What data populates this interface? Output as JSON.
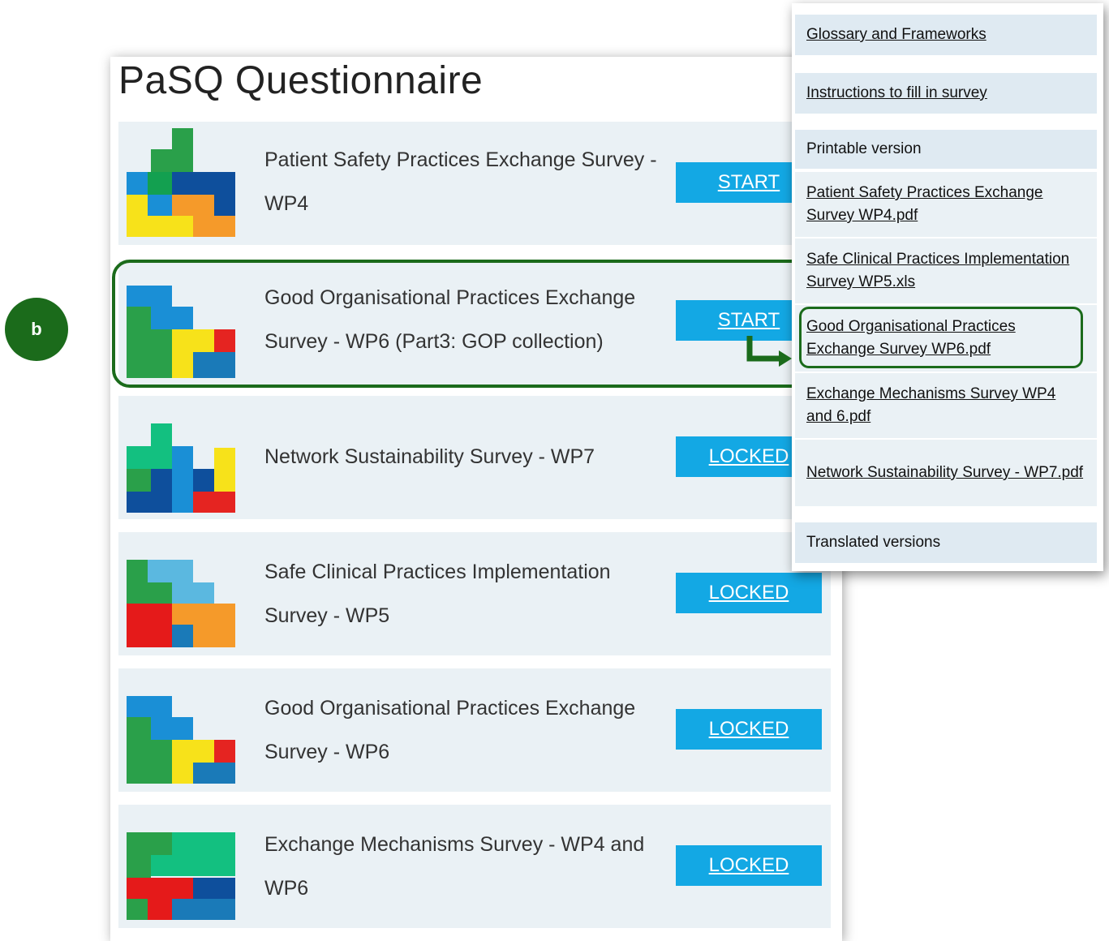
{
  "page": {
    "title": "PaSQ Questionnaire"
  },
  "surveys": [
    {
      "name": "Patient Safety Practices Exchange Survey - WP4",
      "button": "START",
      "logo": "wp4-logo"
    },
    {
      "name": "Good Organisational Practices Exchange Survey - WP6 (Part3: GOP collection)",
      "button": "START",
      "logo": "wp6-logo"
    },
    {
      "name": "Network Sustainability Survey - WP7",
      "button": "LOCKED",
      "logo": "wp7-logo"
    },
    {
      "name": "Safe Clinical Practices Implementation Survey - WP5",
      "button": "LOCKED",
      "logo": "wp5-logo"
    },
    {
      "name": "Good Organisational Practices Exchange Survey - WP6",
      "button": "LOCKED",
      "logo": "wp6-logo"
    },
    {
      "name": "Exchange Mechanisms Survey - WP4 and WP6",
      "button": "LOCKED",
      "logo": "wp4-wp6-logo"
    }
  ],
  "annotation": {
    "badge": "b"
  },
  "side_menu": {
    "glossary": "Glossary and Frameworks",
    "instructions": "Instructions to fill in survey",
    "printable": "Printable version",
    "printable_items": [
      "Patient Safety Practices Exchange Survey WP4.pdf",
      "Safe Clinical Practices Implementation Survey WP5.xls",
      "Good Organisational Practices Exchange Survey WP6.pdf",
      "Exchange Mechanisms Survey WP4 and 6.pdf",
      "Network Sustainability Survey - WP7.pdf"
    ],
    "translated": "Translated versions"
  },
  "colors": {
    "accent": "#13a8e4",
    "highlight": "#1b6b1b",
    "row_bg": "#eaf1f5",
    "menu_bg": "#dfeaf2"
  }
}
